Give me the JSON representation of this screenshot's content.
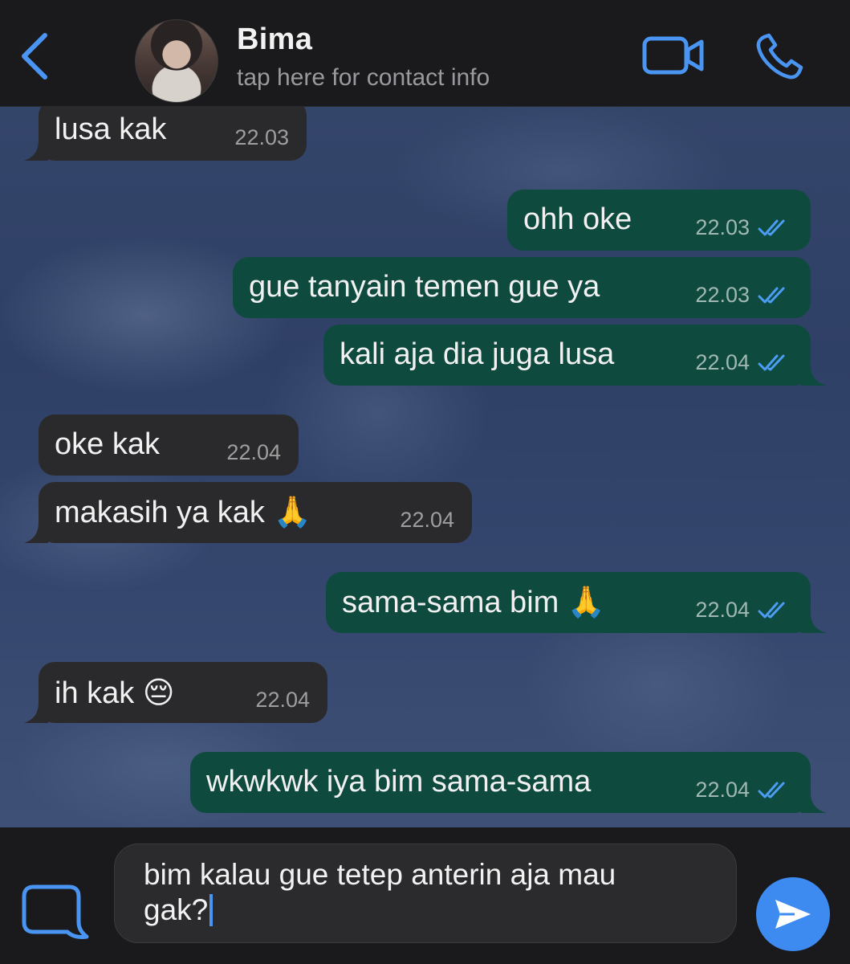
{
  "header": {
    "contact_name": "Bima",
    "contact_subtitle": "tap here for contact info"
  },
  "messages": [
    {
      "direction": "in",
      "text": "lusa kak",
      "time": "22.03"
    },
    {
      "direction": "out",
      "text": "ohh oke",
      "time": "22.03",
      "status": "read"
    },
    {
      "direction": "out",
      "text": "gue tanyain temen gue ya",
      "time": "22.03",
      "status": "read"
    },
    {
      "direction": "out",
      "text": "kali aja dia juga lusa",
      "time": "22.04",
      "status": "read"
    },
    {
      "direction": "in",
      "text": "oke kak",
      "time": "22.04"
    },
    {
      "direction": "in",
      "text": "makasih ya kak 🙏",
      "time": "22.04"
    },
    {
      "direction": "out",
      "text": "sama-sama bim 🙏",
      "time": "22.04",
      "status": "read"
    },
    {
      "direction": "in",
      "text": "ih kak 😔",
      "time": "22.04"
    },
    {
      "direction": "out",
      "text": "wkwkwk iya bim sama-sama",
      "time": "22.04",
      "status": "read"
    }
  ],
  "composer": {
    "draft": "bim kalau gue tetep anterin aja mau\ngak?"
  },
  "colors": {
    "accent": "#3d8bf0",
    "incoming_bubble": "#2a2a2c",
    "outgoing_bubble": "#0f4a3f",
    "read_ticks": "#4a9df2"
  },
  "icons": {
    "back": "chevron-left-icon",
    "video": "video-camera-icon",
    "call": "phone-icon",
    "attach": "attachment-icon",
    "send": "send-icon"
  }
}
